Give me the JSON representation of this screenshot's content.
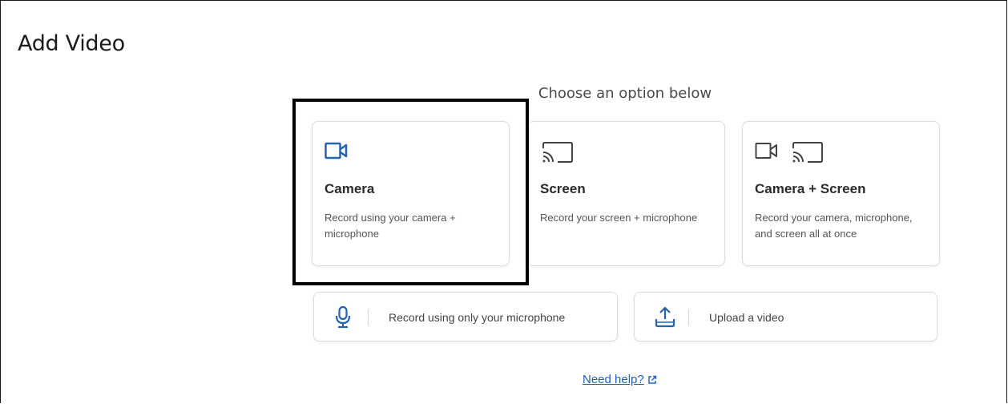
{
  "page": {
    "title": "Add Video",
    "subtitle": "Choose an option below"
  },
  "options": [
    {
      "title": "Camera",
      "description": "Record using your camera + microphone",
      "icons": [
        "video-camera-icon"
      ]
    },
    {
      "title": "Screen",
      "description": "Record your screen + microphone",
      "icons": [
        "cast-screen-icon"
      ]
    },
    {
      "title": "Camera + Screen",
      "description": "Record your camera, microphone, and screen all at once",
      "icons": [
        "video-camera-icon",
        "cast-screen-icon"
      ]
    }
  ],
  "secondary_options": [
    {
      "label": "Record using only your microphone",
      "icon": "microphone-icon"
    },
    {
      "label": "Upload a video",
      "icon": "upload-icon"
    }
  ],
  "help": {
    "label": "Need help?",
    "icon": "external-link-icon"
  },
  "colors": {
    "accent": "#2563b0",
    "icon_gray": "#444444",
    "link": "#1f5fbf",
    "highlight_border": "#000000"
  }
}
